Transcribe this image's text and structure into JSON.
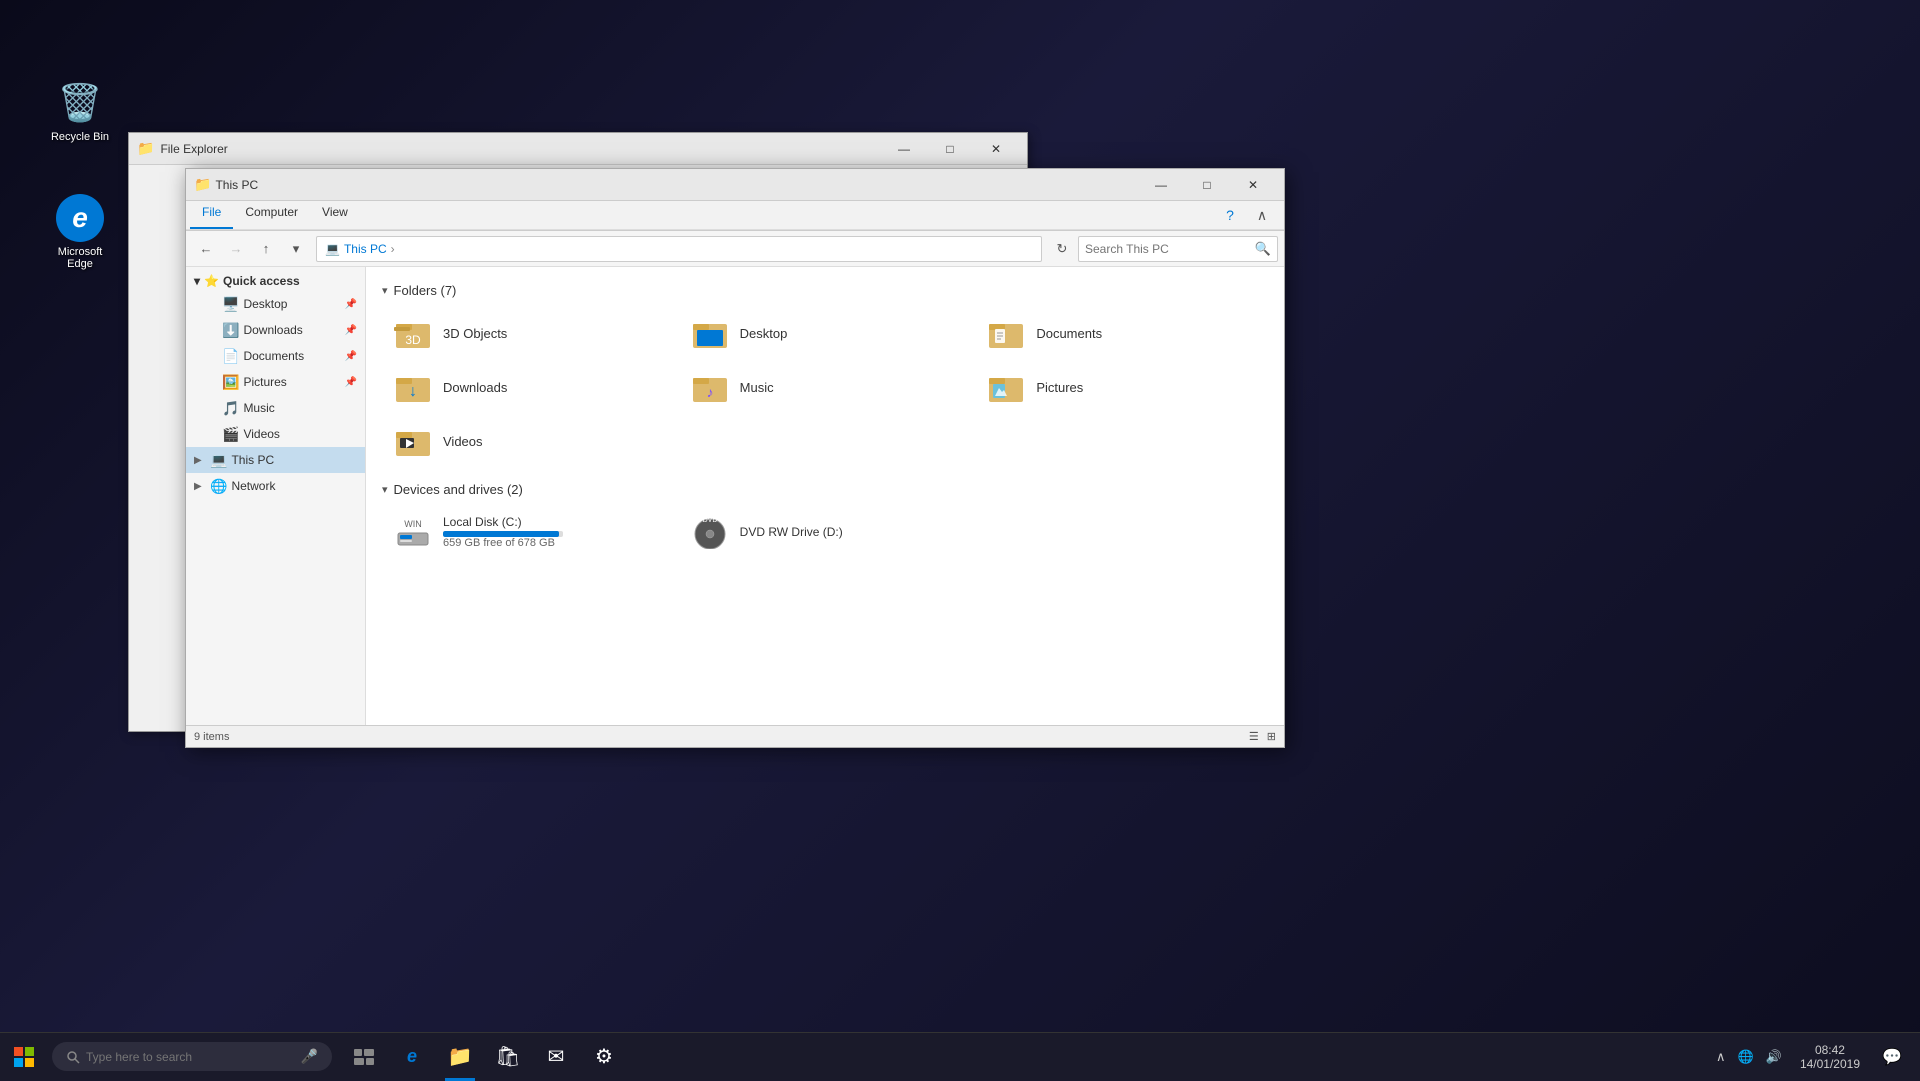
{
  "desktop": {
    "icons": [
      {
        "id": "recycle-bin",
        "label": "Recycle Bin",
        "emoji": "🗑️"
      },
      {
        "id": "microsoft-edge",
        "label": "Microsoft Edge",
        "emoji": "🌐"
      }
    ]
  },
  "window_back": {
    "title": "File Explorer"
  },
  "window_main": {
    "title": "This PC",
    "ribbon": {
      "tabs": [
        "File",
        "Computer",
        "View"
      ]
    },
    "active_tab": "File",
    "nav": {
      "address": "This PC",
      "search_placeholder": "Search This PC"
    },
    "sidebar": {
      "sections": [
        {
          "id": "quick-access",
          "label": "Quick access",
          "expanded": true,
          "items": [
            {
              "id": "desktop",
              "label": "Desktop",
              "pinned": true
            },
            {
              "id": "downloads",
              "label": "Downloads",
              "pinned": true
            },
            {
              "id": "documents",
              "label": "Documents",
              "pinned": true
            },
            {
              "id": "pictures",
              "label": "Pictures",
              "pinned": true
            },
            {
              "id": "music",
              "label": "Music"
            },
            {
              "id": "videos",
              "label": "Videos"
            }
          ]
        },
        {
          "id": "this-pc",
          "label": "This PC",
          "expanded": true,
          "selected": true
        },
        {
          "id": "network",
          "label": "Network",
          "expanded": false
        }
      ]
    },
    "folders_section": {
      "label": "Folders (7)",
      "folders": [
        {
          "id": "3d-objects",
          "label": "3D Objects",
          "emoji": "📦"
        },
        {
          "id": "desktop",
          "label": "Desktop",
          "emoji": "🖥️"
        },
        {
          "id": "documents",
          "label": "Documents",
          "emoji": "📄"
        },
        {
          "id": "downloads",
          "label": "Downloads",
          "emoji": "⬇️"
        },
        {
          "id": "music",
          "label": "Music",
          "emoji": "🎵"
        },
        {
          "id": "pictures",
          "label": "Pictures",
          "emoji": "🖼️"
        },
        {
          "id": "videos",
          "label": "Videos",
          "emoji": "🎬"
        }
      ]
    },
    "drives_section": {
      "label": "Devices and drives (2)",
      "drives": [
        {
          "id": "c-drive",
          "label": "Local Disk (C:)",
          "space": "659 GB free of 678 GB",
          "fill_pct": 97,
          "emoji": "💻"
        },
        {
          "id": "d-drive",
          "label": "DVD RW Drive (D:)",
          "space": "",
          "emoji": "💿"
        }
      ]
    },
    "status": "9 items"
  },
  "taskbar": {
    "search_placeholder": "Type here to search",
    "time": "08:42",
    "date": "14/01/2019",
    "apps": [
      {
        "id": "task-view",
        "icon": "⊞"
      },
      {
        "id": "edge",
        "icon": "e"
      },
      {
        "id": "file-explorer",
        "icon": "📁"
      },
      {
        "id": "store",
        "icon": "🛍"
      },
      {
        "id": "mail",
        "icon": "✉"
      },
      {
        "id": "settings",
        "icon": "⚙"
      }
    ]
  }
}
